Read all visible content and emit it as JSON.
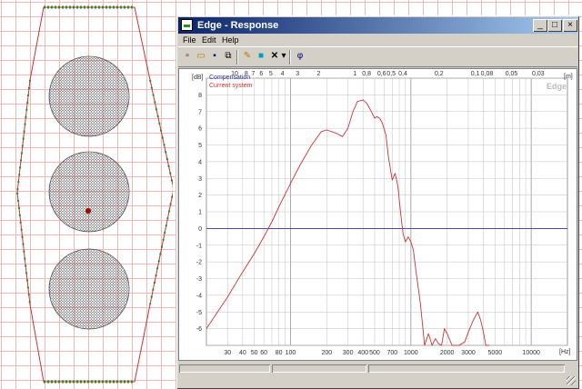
{
  "window": {
    "title": "Edge - Response",
    "controls": {
      "minimize": "_",
      "maximize": "□",
      "close": "×"
    }
  },
  "menu": {
    "items": [
      "File",
      "Edit",
      "Help"
    ]
  },
  "toolbar": {
    "buttons": [
      {
        "name": "new-file-icon",
        "glyph": "▫"
      },
      {
        "name": "open-folder-icon",
        "glyph": "▭"
      },
      {
        "name": "save-icon",
        "glyph": "▪"
      },
      {
        "name": "copy-icon",
        "glyph": "⧉"
      },
      {
        "name": "pencil-icon",
        "glyph": "✎"
      },
      {
        "name": "cyan-square-icon",
        "glyph": "■"
      },
      {
        "name": "cross-icon",
        "glyph": "✕"
      },
      {
        "name": "dropdown-arrow-icon",
        "glyph": "▾"
      },
      {
        "name": "phi-icon",
        "glyph": "φ"
      }
    ]
  },
  "watermark": "Edge",
  "colors": {
    "compensation": "#3333aa",
    "current": "#cc3333",
    "grid": "#c0c0c0",
    "baffle_outline": "#cc3333",
    "baffle_edge": "#2a8a2a"
  },
  "chart_data": {
    "type": "line",
    "xscale": "log",
    "xlim": [
      20,
      20000
    ],
    "ylim": [
      -7,
      9
    ],
    "ylabel": "[dB]",
    "xlabel": "[Hz]",
    "top_axis_unit": "[m]",
    "x_ticks": [
      "30",
      "40",
      "50",
      "60",
      "80",
      "100",
      "200",
      "300",
      "400",
      "500",
      "700",
      "1000",
      "2000",
      "3000",
      "5000",
      "10000"
    ],
    "y_ticks": [
      "8",
      "7",
      "6",
      "5",
      "4",
      "3",
      "2",
      "1",
      "0",
      "-1",
      "-2",
      "-3",
      "-4",
      "-5",
      "-6"
    ],
    "top_ticks": [
      {
        "label": "10",
        "m": 10
      },
      {
        "label": "8",
        "m": 8
      },
      {
        "label": "7",
        "m": 7
      },
      {
        "label": "6",
        "m": 6
      },
      {
        "label": "5",
        "m": 5
      },
      {
        "label": "4",
        "m": 4
      },
      {
        "label": "3",
        "m": 3
      },
      {
        "label": "2",
        "m": 2
      },
      {
        "label": "1",
        "m": 1
      },
      {
        "label": "0,8",
        "m": 0.8
      },
      {
        "label": "0,6",
        "m": 0.6
      },
      {
        "label": "0,5",
        "m": 0.5
      },
      {
        "label": "0,4",
        "m": 0.4
      },
      {
        "label": "0,2",
        "m": 0.2
      },
      {
        "label": "0,1",
        "m": 0.1
      },
      {
        "label": "0,08",
        "m": 0.08
      },
      {
        "label": "0,05",
        "m": 0.05
      },
      {
        "label": "0,03",
        "m": 0.03
      }
    ],
    "series": [
      {
        "name": "Compensation",
        "x": [
          20,
          20000
        ],
        "y": [
          0,
          0
        ]
      },
      {
        "name": "Current system",
        "x": [
          20,
          30,
          40,
          50,
          60,
          70,
          80,
          100,
          120,
          150,
          180,
          200,
          240,
          270,
          300,
          330,
          360,
          400,
          430,
          470,
          500,
          520,
          550,
          580,
          620,
          650,
          700,
          740,
          780,
          820,
          860,
          900,
          950,
          1000,
          1050,
          1100,
          1200,
          1300,
          1400,
          1500,
          1600,
          1700,
          1800,
          1900,
          2000,
          2200,
          2500,
          2800,
          3000,
          3300,
          3600,
          3800,
          4000,
          4200,
          4500
        ],
        "y": [
          -6,
          -4.1,
          -2.6,
          -1.5,
          -0.5,
          0.4,
          1.3,
          2.7,
          3.8,
          5.0,
          5.8,
          5.9,
          5.7,
          5.5,
          6.0,
          7.0,
          7.6,
          7.7,
          7.5,
          7.0,
          6.6,
          6.7,
          6.6,
          6.3,
          5.6,
          4.3,
          2.9,
          3.3,
          2.5,
          1.0,
          -0.3,
          -0.8,
          -0.5,
          -0.8,
          -1.3,
          -2.5,
          -4.5,
          -7.0,
          -6.3,
          -7.0,
          -6.6,
          -6.9,
          -7.0,
          -6.0,
          -6.3,
          -7.0,
          -7.0,
          -6.8,
          -6.2,
          -5.5,
          -5.0,
          -5.5,
          -6.2,
          -7.0,
          -7.0
        ]
      }
    ]
  }
}
